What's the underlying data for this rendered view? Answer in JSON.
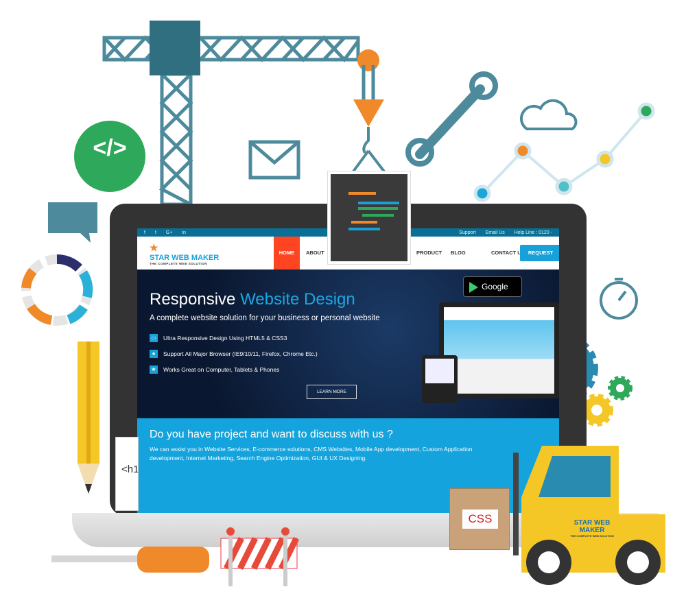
{
  "illustration": {
    "code_symbol": "</>",
    "h1_tag": "<h1",
    "css_label": "CSS",
    "truck_logo": "STAR WEB MAKER",
    "truck_tagline": "THE COMPLETE WEB SOLUTION"
  },
  "website": {
    "topbar": {
      "social": [
        "f",
        "t",
        "G+",
        "in"
      ],
      "links": [
        "Support",
        "Email Us",
        "Help Line : 0120 -"
      ]
    },
    "logo": {
      "name": "STAR WEB MAKER",
      "tagline": "THE COMPLETE WEB SOLUTION"
    },
    "nav": {
      "items": [
        "HOME",
        "ABOUT",
        "PRODUCT",
        "BLOG",
        "CONTACT US"
      ],
      "request": "REQUEST",
      "active": "HOME"
    },
    "hero": {
      "title_a": "Responsive",
      "title_b": "Website Design",
      "subtitle": "A complete website solution for your business or personal website",
      "features": [
        "Ultra Responsive Design Using HTML5 & CSS3",
        "Support All Major Browser (IE9/10/11, Firefox, Chrome Etc.)",
        "Works Great on Computer, Tablets & Phones"
      ],
      "learn_more": "LEARN MORE",
      "google_play": "Google play"
    },
    "band": {
      "title": "Do you have project and want to discuss with us ?",
      "text": "We can assist you in Website Services, E-commerce solutions, CMS Websites, Mobile App development, Custom Application development, Internet Marketing, Search Engine Optimization, GUI & UX Designing."
    }
  },
  "colors": {
    "teal": "#4d8a9c",
    "orange": "#f0892a",
    "green": "#2ea85a",
    "blue": "#1aa0d8",
    "red": "#ff4422",
    "yellow": "#f5c726"
  }
}
